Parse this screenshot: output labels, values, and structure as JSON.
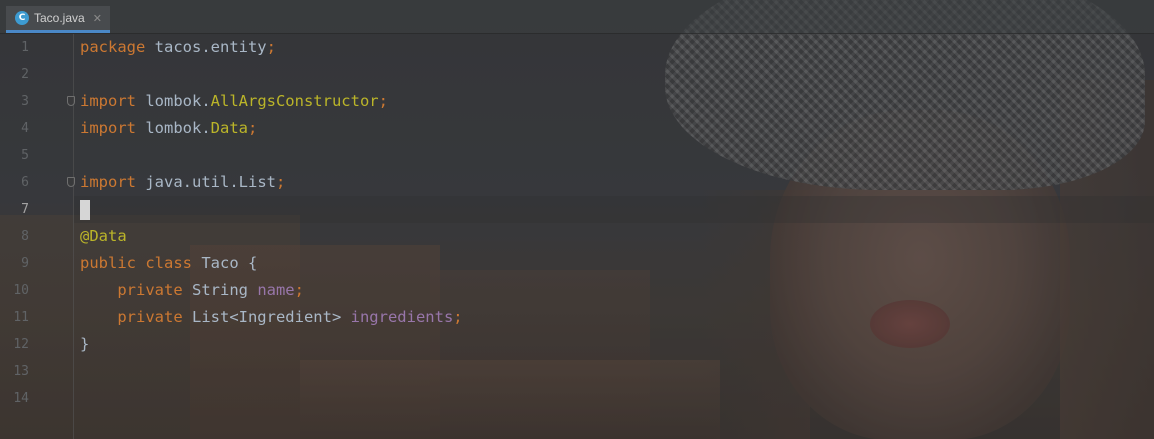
{
  "tab": {
    "icon_letter": "C",
    "label": "Taco.java",
    "close_glyph": "✕"
  },
  "gutter": {
    "line_numbers": [
      "1",
      "2",
      "3",
      "4",
      "5",
      "6",
      "7",
      "8",
      "9",
      "10",
      "11",
      "12",
      "13",
      "14"
    ],
    "current_line": "7"
  },
  "code": {
    "line1": {
      "kw": "package",
      "rest": " tacos.entity",
      "semi": ";"
    },
    "line3": {
      "kw": "import",
      "pkg": " lombok.",
      "name": "AllArgsConstructor",
      "semi": ";"
    },
    "line4": {
      "kw": "import",
      "pkg": " lombok.",
      "name": "Data",
      "semi": ";"
    },
    "line6": {
      "kw": "import",
      "rest": " java.util.List",
      "semi": ";"
    },
    "line8": {
      "ann": "@Data"
    },
    "line9": {
      "kw1": "public",
      "kw2": "class",
      "rest": " Taco {"
    },
    "line10": {
      "kw": "private",
      "type": " String ",
      "field": "name",
      "semi": ";"
    },
    "line11": {
      "kw": "private",
      "type": " List<Ingredient> ",
      "field": "ingredients",
      "semi": ";"
    },
    "line12": {
      "rest": "}"
    }
  },
  "colors": {
    "keyword": "#cc7832",
    "annotation": "#bbb529",
    "field": "#9876aa",
    "text": "#a9b7c6",
    "tab_accent": "#4a88c7"
  }
}
